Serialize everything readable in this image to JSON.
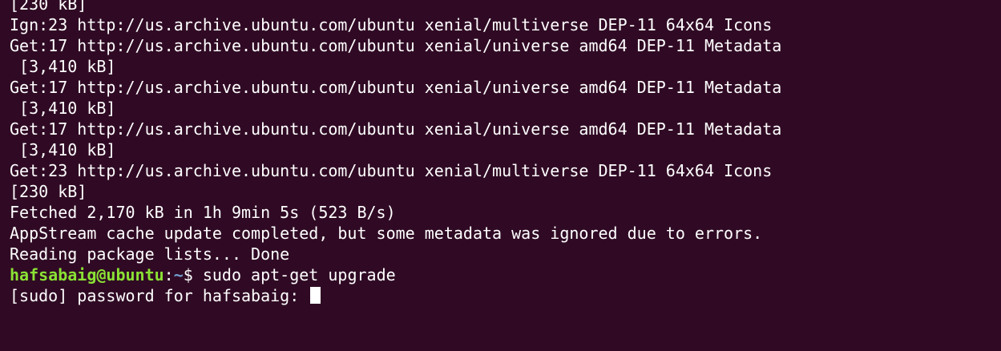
{
  "terminal": {
    "output_lines": [
      "[230 kB]",
      "Ign:23 http://us.archive.ubuntu.com/ubuntu xenial/multiverse DEP-11 64x64 Icons",
      "Get:17 http://us.archive.ubuntu.com/ubuntu xenial/universe amd64 DEP-11 Metadata",
      " [3,410 kB]",
      "Get:17 http://us.archive.ubuntu.com/ubuntu xenial/universe amd64 DEP-11 Metadata",
      " [3,410 kB]",
      "Get:17 http://us.archive.ubuntu.com/ubuntu xenial/universe amd64 DEP-11 Metadata",
      " [3,410 kB]",
      "Get:23 http://us.archive.ubuntu.com/ubuntu xenial/multiverse DEP-11 64x64 Icons",
      "[230 kB]",
      "Fetched 2,170 kB in 1h 9min 5s (523 B/s)",
      "AppStream cache update completed, but some metadata was ignored due to errors.",
      "Reading package lists... Done"
    ],
    "prompt": {
      "user_host": "hafsabaig@ubuntu",
      "separator": ":",
      "path": "~",
      "symbol": "$ ",
      "command": "sudo apt-get upgrade"
    },
    "password_prompt": "[sudo] password for hafsabaig: ",
    "colors": {
      "background": "#300a24",
      "text": "#ffffff",
      "user_host": "#8ae234",
      "path": "#729fcf"
    }
  }
}
